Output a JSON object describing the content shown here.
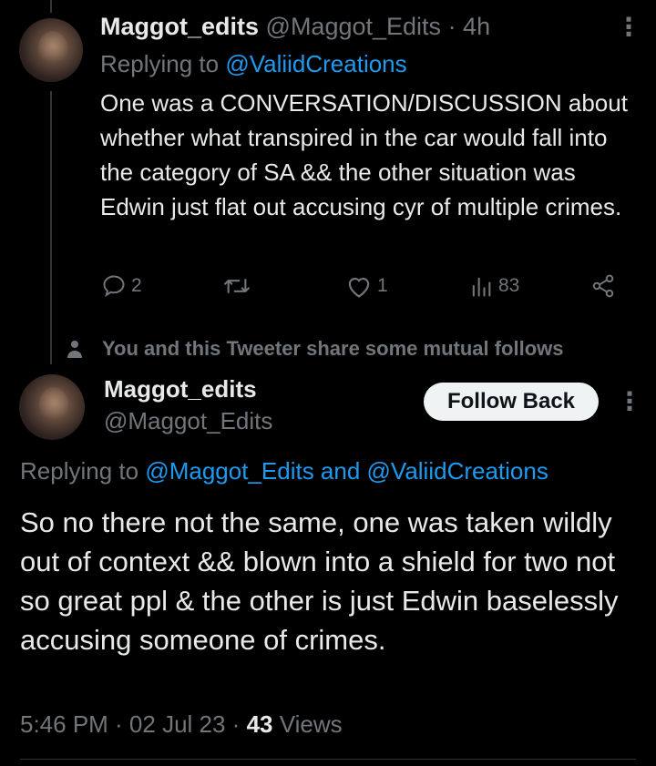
{
  "reply_tweet": {
    "display_name": "Maggot_edits",
    "handle": "@Maggot_Edits",
    "time": "· 4h",
    "replying_prefix": "Replying to",
    "replying_to": "@ValiidCreations",
    "text": "One was a CONVERSATION/DISCUSSION about whether what transpired in the car would fall into the category of SA && the other situation was Edwin just flat out accusing cyr of multiple crimes.",
    "actions": {
      "replies": "2",
      "retweets": "",
      "likes": "1",
      "views": "83"
    },
    "icons": [
      "reply-icon",
      "retweet-icon",
      "like-icon",
      "views-icon",
      "share-icon",
      "more-icon"
    ]
  },
  "mutual_notice": {
    "text": "You and this Tweeter share some mutual follows",
    "icon": "person-icon"
  },
  "main_tweet": {
    "display_name": "Maggot_edits",
    "handle": "@Maggot_Edits",
    "follow_button": "Follow Back",
    "replying_prefix": "Replying to",
    "replying_to": "@Maggot_Edits and @ValiidCreations",
    "text": "So no there not the same, one was taken wildly out of context && blown into a shield for two not so great ppl & the other is just Edwin baselessly accusing someone of crimes.",
    "timestamp": "5:46 PM · 02 Jul 23 ·",
    "views_count": "43",
    "views_label": "Views"
  },
  "colors": {
    "background": "#000000",
    "text": "#e7e9ea",
    "muted": "#71767b",
    "link": "#1d9bf0",
    "button_bg": "#eff3f4"
  }
}
